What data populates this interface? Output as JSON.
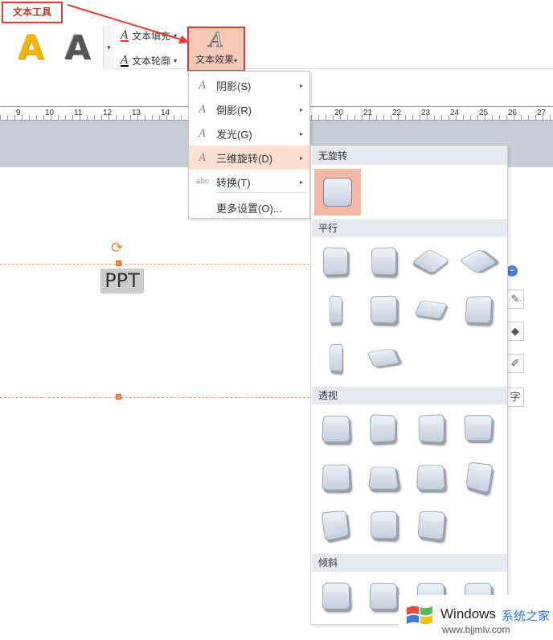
{
  "ribbon": {
    "active_tab": "文本工具",
    "text_fill_label": "文本填充",
    "text_outline_label": "文本轮廓",
    "text_effect_label": "文本效果",
    "style_a_glyph": "A",
    "effect_glyph": "A",
    "dropdown_caret": "▾"
  },
  "ruler": {
    "numbers": [
      "9",
      "10",
      "11",
      "12",
      "13",
      "14",
      "",
      "",
      "",
      "",
      "",
      "20",
      "21",
      "22",
      "23",
      "24",
      "25",
      "26",
      "27"
    ]
  },
  "document": {
    "text_box_content": "PPT"
  },
  "effect_menu": {
    "items": [
      {
        "label": "阴影(S)",
        "icon": "A",
        "has_submenu": true
      },
      {
        "label": "倒影(R)",
        "icon": "A",
        "has_submenu": true
      },
      {
        "label": "发光(G)",
        "icon": "A",
        "has_submenu": true
      },
      {
        "label": "三维旋转(D)",
        "icon": "A",
        "has_submenu": true
      },
      {
        "label": "转换(T)",
        "icon": "abc",
        "has_submenu": true
      },
      {
        "label": "更多设置(O)...",
        "icon": "",
        "has_submenu": false
      }
    ],
    "arrow": "▸"
  },
  "rotation_submenu": {
    "sections": [
      {
        "title": "无旋转"
      },
      {
        "title": "平行"
      },
      {
        "title": "透视"
      },
      {
        "title": "倾斜"
      }
    ]
  },
  "side_tools": {
    "minus": "−",
    "char_label": "字"
  },
  "watermark": {
    "brand": "Windows",
    "cn_text": "系统之家",
    "url": "www.bjjmlv.com"
  },
  "colors": {
    "accent_red": "#e53935",
    "selection_fill": "#f9c9b8",
    "menu_hover": "#fde0d0",
    "guide_orange": "#f0a070",
    "gray_band": "#c8cdd6"
  }
}
